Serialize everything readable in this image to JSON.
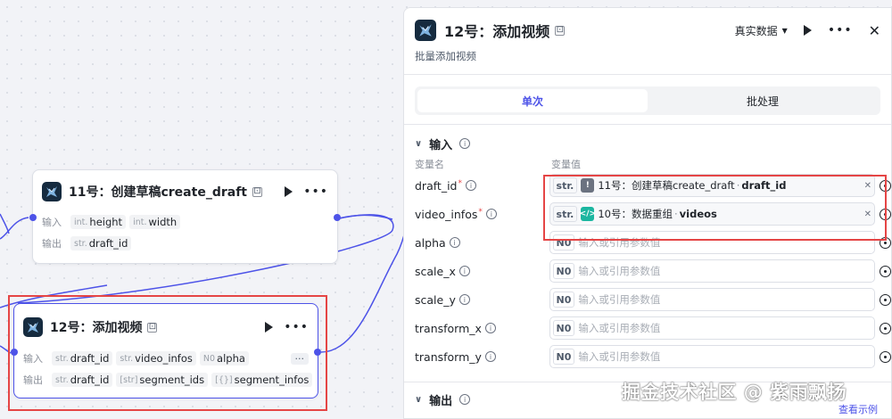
{
  "canvas": {
    "node11": {
      "title": "11号：创建草稿create_draft",
      "input_label": "输入",
      "output_label": "输出",
      "inputs": [
        {
          "type": "int.",
          "name": "height"
        },
        {
          "type": "int.",
          "name": "width"
        }
      ],
      "outputs": [
        {
          "type": "str.",
          "name": "draft_id"
        }
      ]
    },
    "node12": {
      "title": "12号：添加视频",
      "input_label": "输入",
      "output_label": "输出",
      "inputs": [
        {
          "type": "str.",
          "name": "draft_id"
        },
        {
          "type": "str.",
          "name": "video_infos"
        },
        {
          "type": "N0",
          "name": "alpha"
        }
      ],
      "more": "···",
      "outputs": [
        {
          "type": "str.",
          "name": "draft_id"
        },
        {
          "type": "[str]",
          "name": "segment_ids"
        },
        {
          "type": "[{}]",
          "name": "segment_infos"
        }
      ]
    }
  },
  "panel": {
    "title": "12号：添加视频",
    "subtitle": "批量添加视频",
    "data_mode": "真实数据",
    "tabs": [
      {
        "label": "单次",
        "active": true
      },
      {
        "label": "批处理",
        "active": false
      }
    ],
    "input_section": {
      "title": "输入",
      "col_name": "变量名",
      "col_value": "变量值",
      "fields": [
        {
          "name": "draft_id",
          "required": true,
          "type": "str.",
          "ref_node": "11号：创建草稿create_draft",
          "ref_var": "draft_id",
          "ref_icon": "warning-icon"
        },
        {
          "name": "video_infos",
          "required": true,
          "type": "str.",
          "ref_node": "10号：数据重组",
          "ref_var": "videos",
          "ref_icon": "code-icon"
        },
        {
          "name": "alpha",
          "required": false,
          "type": "N0",
          "placeholder": "输入或引用参数值"
        },
        {
          "name": "scale_x",
          "required": false,
          "type": "N0",
          "placeholder": "输入或引用参数值"
        },
        {
          "name": "scale_y",
          "required": false,
          "type": "N0",
          "placeholder": "输入或引用参数值"
        },
        {
          "name": "transform_x",
          "required": false,
          "type": "N0",
          "placeholder": "输入或引用参数值"
        },
        {
          "name": "transform_y",
          "required": false,
          "type": "N0",
          "placeholder": "输入或引用参数值"
        }
      ]
    },
    "output_section": {
      "title": "输出"
    },
    "example_link": "查看示例"
  },
  "watermark": "掘金技术社区 @ 紫雨飘扬",
  "colors": {
    "accent": "#4d53e8",
    "highlight": "#e54545",
    "code_icon": "#1bb6a0"
  }
}
